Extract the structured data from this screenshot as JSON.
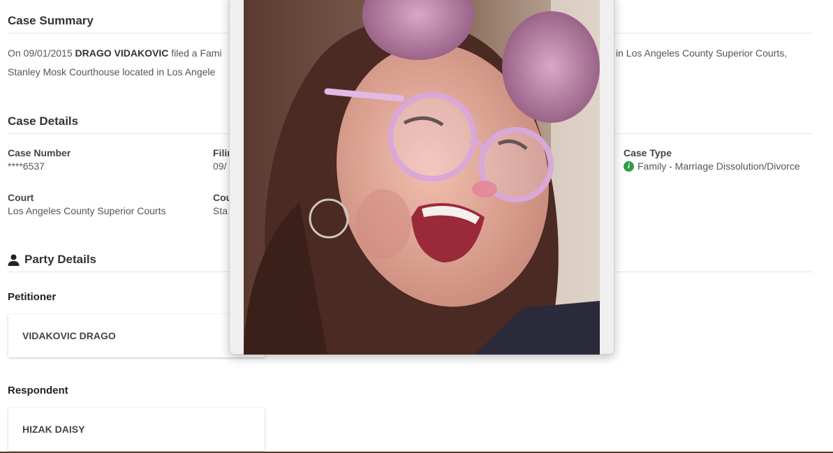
{
  "case_summary": {
    "title": "Case Summary",
    "line1_a": "On 09/01/2015 ",
    "line1_name": "DRAGO VIDAKOVIC",
    "line1_b": " filed a Fami",
    "line1_c": "in Los Angeles County Superior Courts,",
    "line2": "Stanley Mosk Courthouse located in Los Angele"
  },
  "case_details": {
    "title": "Case Details",
    "case_number_label": "Case Number",
    "case_number_value": "****6537",
    "filing_label": "Filin",
    "filing_value": "09/",
    "case_type_label": "Case Type",
    "case_type_value": "Family - Marriage Dissolution/Divorce",
    "court_label": "Court",
    "court_value": "Los Angeles County Superior Courts",
    "courthouse_label": "Cou",
    "courthouse_value": "Sta"
  },
  "party_details": {
    "title": "Party Details",
    "petitioner_label": "Petitioner",
    "petitioner_name": "VIDAKOVIC DRAGO",
    "respondent_label": "Respondent",
    "respondent_name": "HIZAK DAISY"
  },
  "icons": {
    "person": "person-icon",
    "info": "info-icon"
  },
  "colors": {
    "info_green": "#2e9e45",
    "heading": "#333333",
    "text": "#555555"
  }
}
